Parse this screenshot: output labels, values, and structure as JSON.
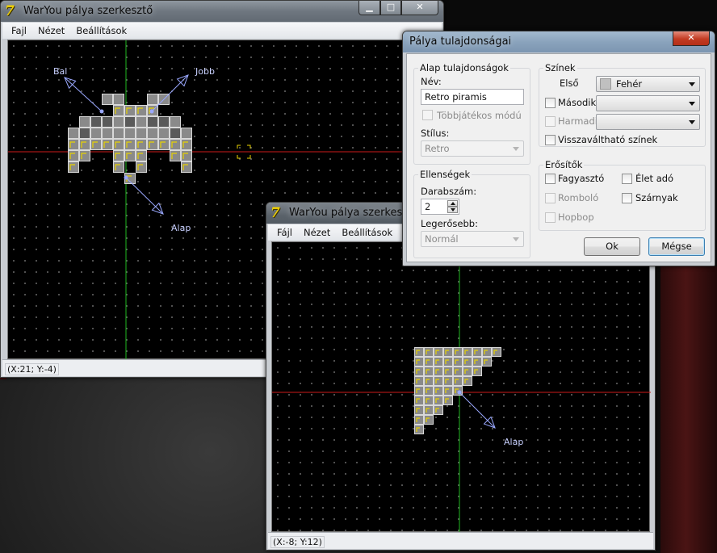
{
  "colors": {
    "canvas_bg": "#000000",
    "axis_x": "#cc1a1a",
    "axis_y": "#1fb81f",
    "block_fill": "#8a8a8a",
    "block_stroke": "#d8d8d8",
    "highlight": "#e8d200",
    "anchor": "#9aa8ff"
  },
  "editor_main": {
    "title": "WarYou pálya szerkesztő",
    "icon": "app-7z-icon",
    "menu": [
      "Fajl",
      "Nézet",
      "Beállítások"
    ],
    "status": "(X:21; Y:-4)",
    "labels": {
      "left": "Bal",
      "right": "Jobb",
      "base": "Alap"
    }
  },
  "editor_second": {
    "title": "WarYou pálya szerkesztő",
    "menu": [
      "Fájl",
      "Nézet",
      "Beállítások"
    ],
    "status": "(X:-8; Y:12)",
    "labels": {
      "base": "Alap"
    }
  },
  "dialog": {
    "title": "Pálya tulajdonságai",
    "close_icon": "close-x-icon",
    "basic": {
      "group_label": "Alap tulajdonságok",
      "name_label": "Név:",
      "name_value": "Retro piramis",
      "multiplayer_label": "Többjátékos módú",
      "style_label": "Stílus:",
      "style_value": "Retro"
    },
    "enemies": {
      "group_label": "Ellenségek",
      "count_label": "Darabszám:",
      "count_value": "2",
      "strongest_label": "Legerősebb:",
      "strongest_value": "Normál"
    },
    "colors": {
      "group_label": "Színek",
      "first_label": "Első",
      "first_value": "Fehér",
      "second_label": "Második",
      "second_value": "",
      "third_label": "Harmadik",
      "third_value": "",
      "reversible_label": "Visszaváltható színek"
    },
    "boosters": {
      "group_label": "Erősítők",
      "freezer": "Fagyasztó",
      "life": "Élet adó",
      "destroyer": "Romboló",
      "wings": "Szárnyak",
      "hopbop": "Hopbop"
    },
    "ok_label": "Ok",
    "cancel_label": "Mégse"
  }
}
